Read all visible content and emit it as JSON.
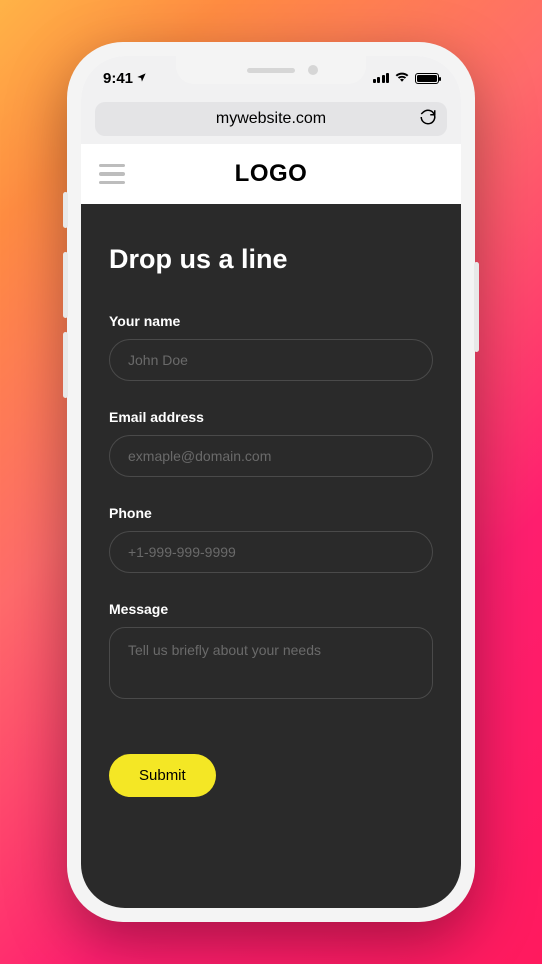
{
  "status": {
    "time": "9:41"
  },
  "browser": {
    "url": "mywebsite.com"
  },
  "header": {
    "logo": "LOGO"
  },
  "form": {
    "heading": "Drop us a line",
    "name": {
      "label": "Your name",
      "placeholder": "John Doe"
    },
    "email": {
      "label": "Email address",
      "placeholder": "exmaple@domain.com"
    },
    "phone": {
      "label": "Phone",
      "placeholder": "+1-999-999-9999"
    },
    "message": {
      "label": "Message",
      "placeholder": "Tell us briefly about your needs"
    },
    "submit": "Submit"
  }
}
